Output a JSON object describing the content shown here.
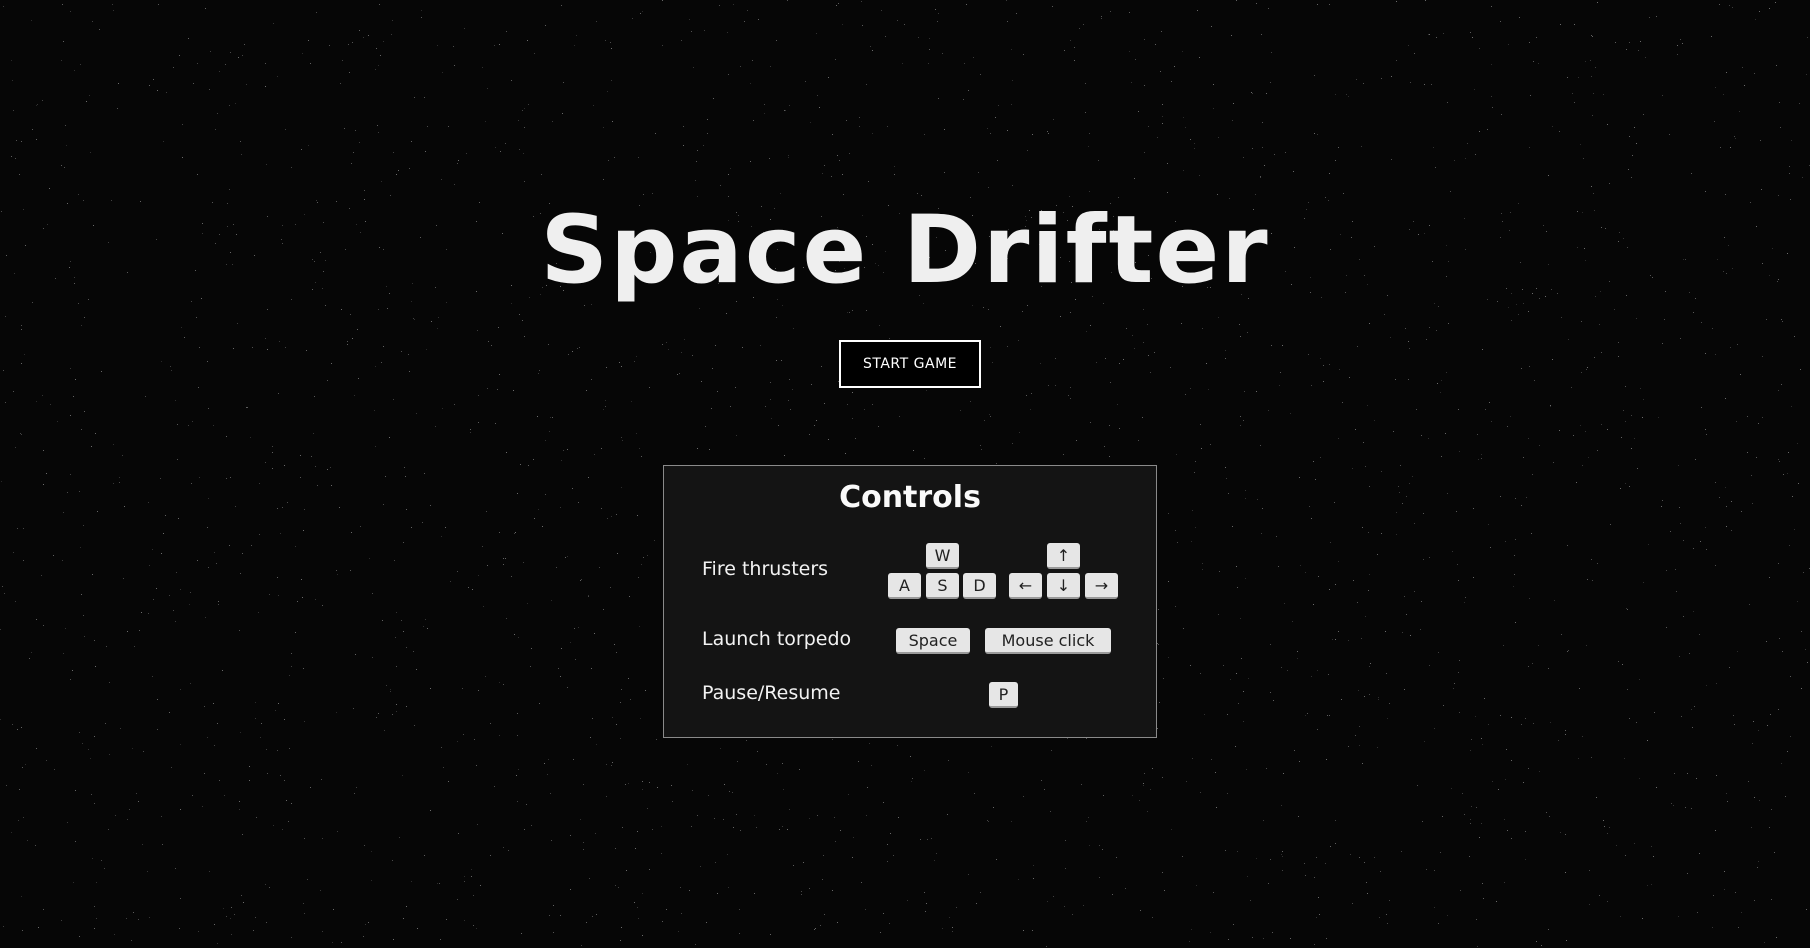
{
  "title": "Space Drifter",
  "start_button": "START GAME",
  "controls": {
    "heading": "Controls",
    "rows": [
      {
        "label": "Fire thrusters",
        "keys_letters": {
          "up": "W",
          "left": "A",
          "down": "S",
          "right": "D"
        },
        "keys_arrows": {
          "up": "↑",
          "left": "←",
          "down": "↓",
          "right": "→"
        }
      },
      {
        "label": "Launch torpedo",
        "keys": [
          "Space",
          "Mouse click"
        ]
      },
      {
        "label": "Pause/Resume",
        "keys": [
          "P"
        ]
      }
    ]
  },
  "colors": {
    "background": "#060606",
    "panel": "#141414",
    "panel_border": "#8a8a8a",
    "key": "#e6e6e6",
    "text": "#f0f0f0"
  }
}
